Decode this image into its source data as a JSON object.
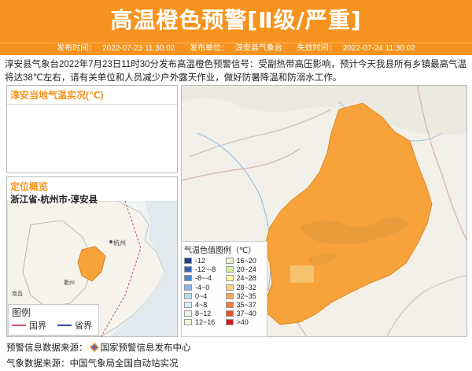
{
  "header": {
    "title": "高温橙色预警[Ⅱ级/严重]",
    "issue_time_label": "发布时间：",
    "issue_time": "2022-07-23 11:30:02",
    "issuer_label": "发布单位：",
    "issuer": "淳安县气象台",
    "expire_label": "失效时间：",
    "expire_time": "2022-07-24 11:30:02"
  },
  "description": "淳安县气象台2022年7月23日11时30分发布高温橙色预警信号：受副热带高压影响，预计今天我县所有乡镇最高气温将达38℃左右，请有关单位和人员减少户外露天作业，做好防暑降温和防溺水工作。",
  "temp_panel": {
    "title": "淳安当地气温实况(℃)"
  },
  "location_panel": {
    "title": "定位概览",
    "path": "浙江省-杭州市-淳安县"
  },
  "small_legend": {
    "title": "图例",
    "items": [
      {
        "label": "国界",
        "color": "#c9596b"
      },
      {
        "label": "省界",
        "color": "#2b4f9e"
      }
    ]
  },
  "temp_legend": {
    "title": "气温色值图例（℃）",
    "items": [
      {
        "label": "-12",
        "color": "#1c3f8a"
      },
      {
        "label": "16~20",
        "color": "#e9f3c6"
      },
      {
        "label": "-12~-8",
        "color": "#2f63b4"
      },
      {
        "label": "20~24",
        "color": "#d6ee9c"
      },
      {
        "label": "-8~-4",
        "color": "#4d86cc"
      },
      {
        "label": "24~28",
        "color": "#fbf3a6"
      },
      {
        "label": "-4~0",
        "color": "#8ab6e6"
      },
      {
        "label": "28~32",
        "color": "#fbd486"
      },
      {
        "label": "0~4",
        "color": "#bcdaf2"
      },
      {
        "label": "32~35",
        "color": "#f6a35a"
      },
      {
        "label": "4~8",
        "color": "#d9ecf8"
      },
      {
        "label": "35~37",
        "color": "#f07b3a"
      },
      {
        "label": "8~12",
        "color": "#e6f4e6"
      },
      {
        "label": "37~40",
        "color": "#e5512a"
      },
      {
        "label": "12~16",
        "color": "#f1f8dc"
      },
      {
        "label": ">40",
        "color": "#c81e1e"
      }
    ]
  },
  "map": {
    "county_fill": "#f7a23a",
    "map_labels": [
      "杭州",
      "衢州",
      "南昌"
    ]
  },
  "sources": {
    "warning_label": "预警信息数据来源：",
    "warning_source": "国家预警信息发布中心",
    "weather_label": "气象数据来源：",
    "weather_source": "中国气象局全国自动站实况"
  },
  "colors": {
    "accent": "#f7931e"
  }
}
